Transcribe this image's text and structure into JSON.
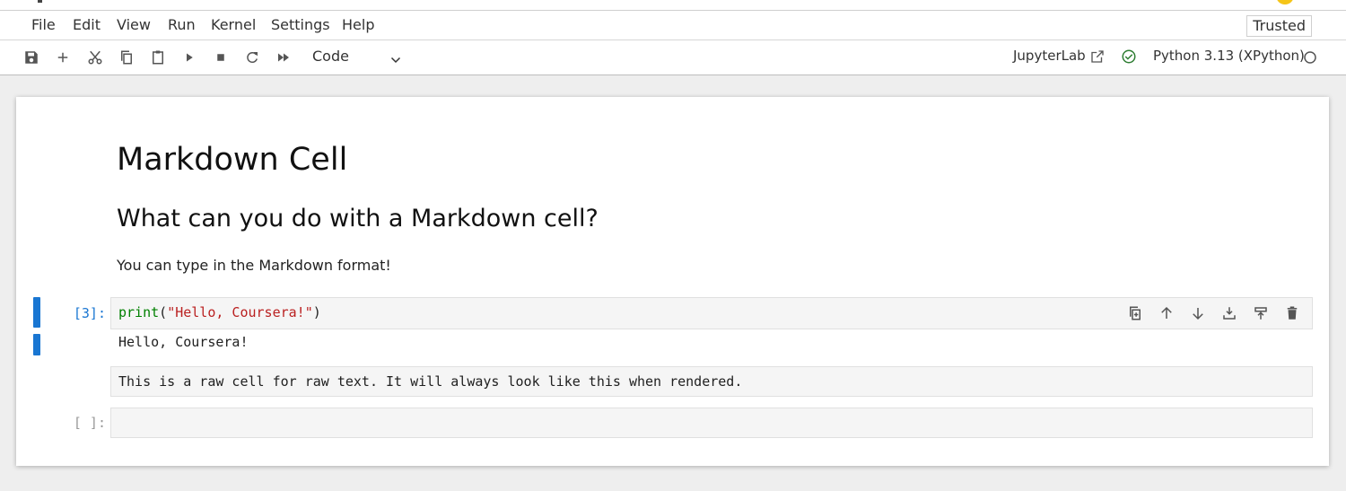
{
  "menubar": {
    "items": [
      "File",
      "Edit",
      "View",
      "Run",
      "Kernel",
      "Settings",
      "Help"
    ],
    "trusted_label": "Trusted"
  },
  "toolbar": {
    "icons": [
      "save-icon",
      "add-cell-icon",
      "cut-icon",
      "copy-icon",
      "paste-icon",
      "run-icon",
      "stop-icon",
      "restart-icon",
      "run-all-icon"
    ],
    "cell_type": "Code",
    "jupyterlab_label": "JupyterLab",
    "kernel_name": "Python 3.13 (XPython)",
    "kernel_status": "idle"
  },
  "notebook": {
    "markdown": {
      "h1": "Markdown Cell",
      "h2": "What can you do with a Markdown cell?",
      "paragraph": "You can type in the Markdown format!"
    },
    "code_cell": {
      "prompt": "[3]:",
      "builtin": "print",
      "open_paren": "(",
      "string": "\"Hello, Coursera!\"",
      "close_paren": ")",
      "output": "Hello, Coursera!"
    },
    "raw_cell": {
      "text": "This is a raw cell for raw text. It will always look like this when rendered."
    },
    "empty_cell": {
      "prompt": "[ ]:"
    },
    "cell_toolbar_icons": [
      "duplicate-icon",
      "move-up-icon",
      "move-down-icon",
      "insert-below-icon",
      "insert-above-icon",
      "delete-icon"
    ]
  },
  "colors": {
    "accent": "#1976d2",
    "kernel_ok": "#2e7d32",
    "string": "#ba2121",
    "builtin": "#008000"
  }
}
